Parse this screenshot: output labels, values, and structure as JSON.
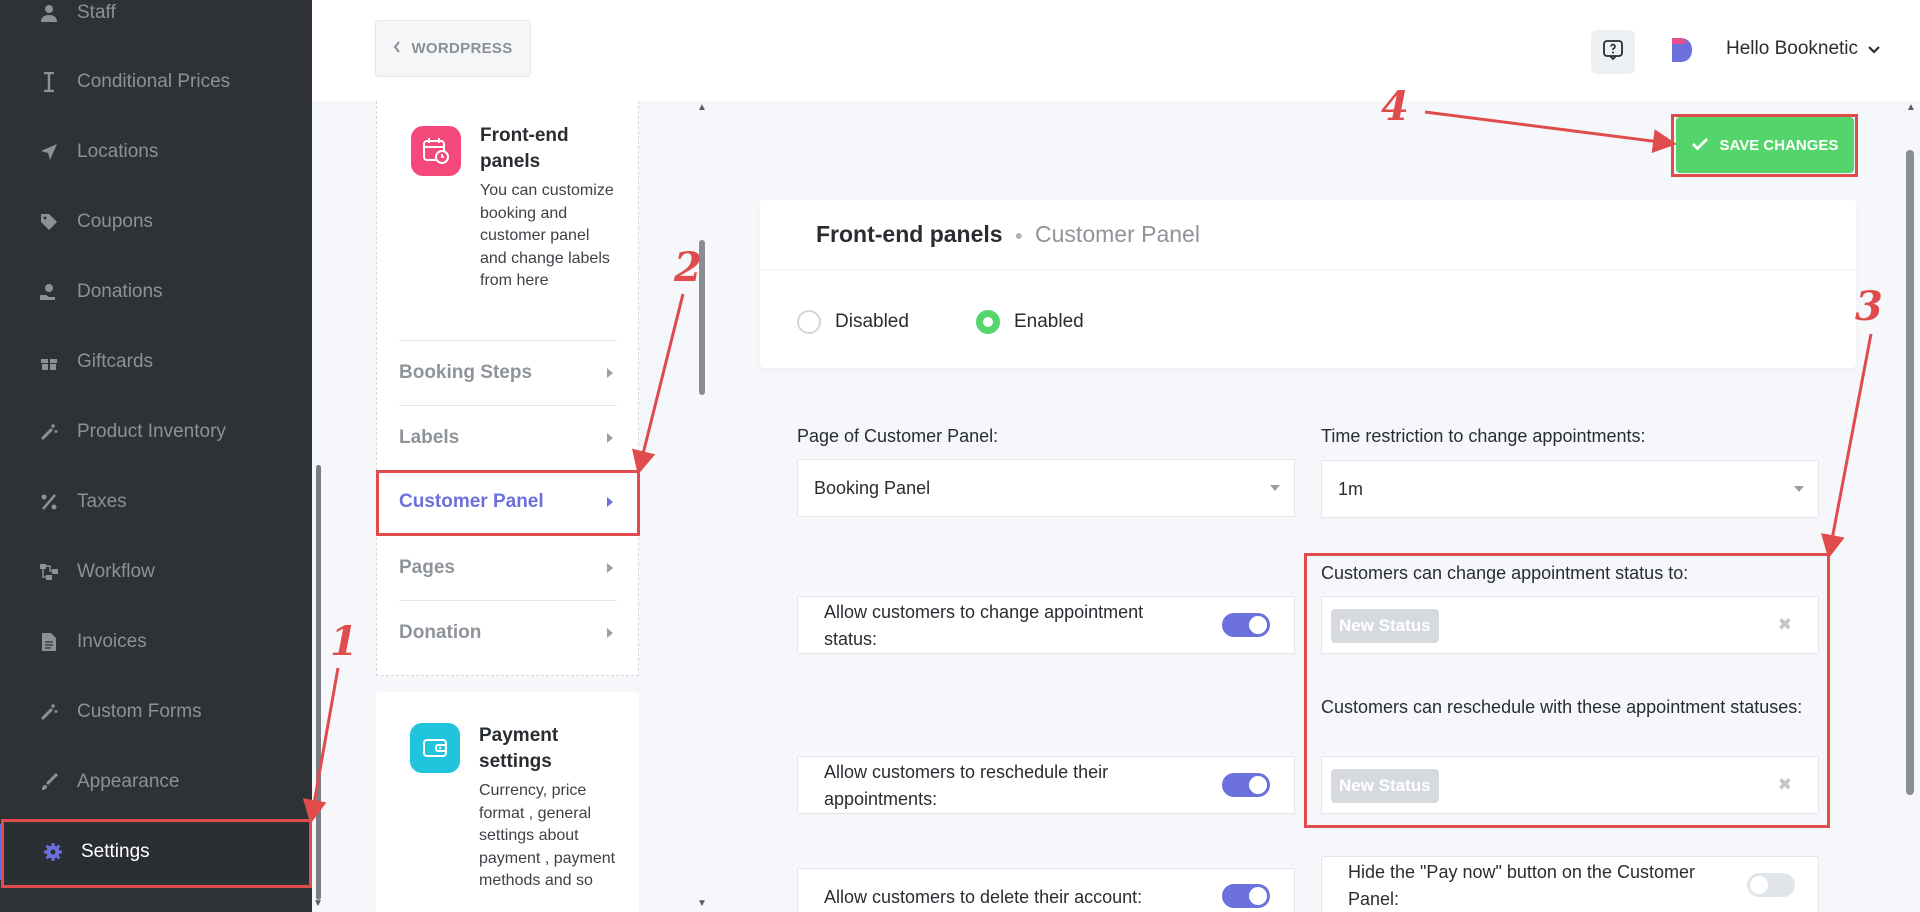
{
  "sidebar": {
    "items": [
      {
        "label": "Staff",
        "icon": "staff-icon"
      },
      {
        "label": "Conditional Prices",
        "icon": "conditional-prices-icon"
      },
      {
        "label": "Locations",
        "icon": "location-arrow-icon"
      },
      {
        "label": "Coupons",
        "icon": "tag-icon"
      },
      {
        "label": "Donations",
        "icon": "donation-hand-icon"
      },
      {
        "label": "Giftcards",
        "icon": "gift-icon"
      },
      {
        "label": "Product Inventory",
        "icon": "magic-wand-icon"
      },
      {
        "label": "Taxes",
        "icon": "percent-icon"
      },
      {
        "label": "Workflow",
        "icon": "workflow-icon"
      },
      {
        "label": "Invoices",
        "icon": "invoice-icon"
      },
      {
        "label": "Custom Forms",
        "icon": "magic-wand-icon"
      },
      {
        "label": "Appearance",
        "icon": "brush-icon"
      },
      {
        "label": "Settings",
        "icon": "gear-icon",
        "active": true
      }
    ]
  },
  "header": {
    "back_label": "WORDPRESS",
    "user_greeting": "Hello Booknetic"
  },
  "settings_menu": {
    "frontend_card": {
      "title": "Front-end panels",
      "description": "You can customize booking and customer panel and change labels from here",
      "icon": "calendar-clock-icon",
      "submenu": [
        "Booking Steps",
        "Labels",
        "Customer Panel",
        "Pages",
        "Donation"
      ],
      "active": "Customer Panel"
    },
    "payment_card": {
      "title": "Payment settings",
      "description": "Currency, price format , general settings about payment , payment methods and so",
      "icon": "wallet-icon"
    }
  },
  "content": {
    "save_label": "SAVE CHANGES",
    "breadcrumb_main": "Front-end panels",
    "breadcrumb_sub": "Customer Panel",
    "radio_disabled": "Disabled",
    "radio_enabled": "Enabled",
    "radio_selected": "Enabled",
    "page_label": "Page of Customer Panel:",
    "page_value": "Booking Panel",
    "time_label": "Time restriction to change appointments:",
    "time_value": "1m",
    "allow_status_label": "Allow customers to change appointment status:",
    "allow_status_on": true,
    "status_to_label": "Customers can change appointment status to:",
    "status_to_tag": "New Status",
    "allow_reschedule_label": "Allow customers to reschedule their appointments:",
    "allow_reschedule_on": true,
    "reschedule_label": "Customers can reschedule with these appointment statuses:",
    "reschedule_tag": "New Status",
    "allow_delete_label": "Allow customers to delete their account:",
    "allow_delete_on": true,
    "hide_pay_label": "Hide the \"Pay now\" button on the Customer Panel:",
    "hide_pay_on": false
  },
  "annotations": {
    "color": "#e04c4c",
    "labels": [
      "1",
      "2",
      "3",
      "4"
    ]
  }
}
